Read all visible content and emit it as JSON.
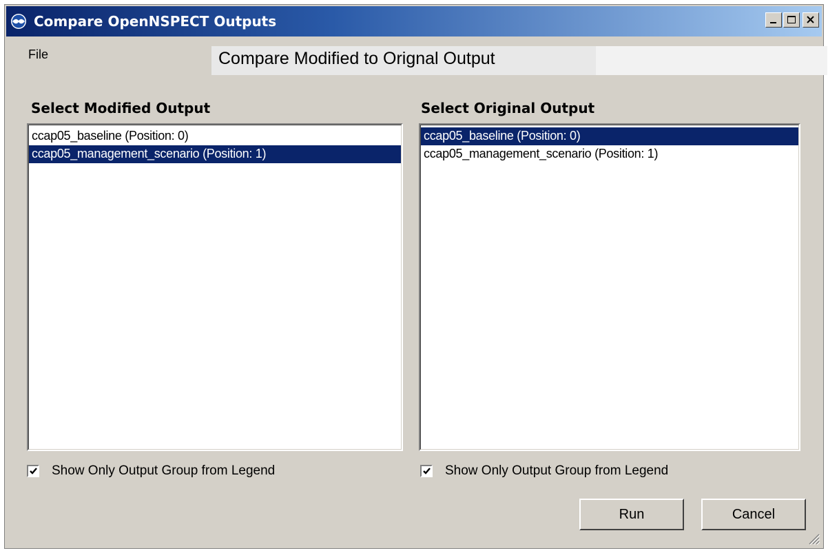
{
  "window": {
    "title": "Compare OpenNSPECT Outputs",
    "title_icon": "noaa-logo-icon",
    "controls": [
      "minimize-icon",
      "maximize-icon",
      "close-icon"
    ]
  },
  "menu": {
    "file_label": "File"
  },
  "header": {
    "title": "Compare Modified to Orignal Output"
  },
  "modified_panel": {
    "label": "Select Modified Output",
    "items": [
      {
        "label": "ccap05_baseline (Position: 0)",
        "selected": false
      },
      {
        "label": "ccap05_management_scenario (Position: 1)",
        "selected": true
      }
    ],
    "checkbox_label": "Show Only Output Group from Legend",
    "checkbox_checked": true
  },
  "original_panel": {
    "label": "Select Original Output",
    "items": [
      {
        "label": "ccap05_baseline (Position: 0)",
        "selected": true
      },
      {
        "label": "ccap05_management_scenario (Position: 1)",
        "selected": false
      }
    ],
    "checkbox_label": "Show Only Output Group from Legend",
    "checkbox_checked": true
  },
  "buttons": {
    "run_label": "Run",
    "cancel_label": "Cancel"
  },
  "colors": {
    "selection": "#0a246a",
    "dialog_bg": "#d4d0c8",
    "titlebar_start": "#0a246a",
    "titlebar_end": "#a6caf0"
  }
}
